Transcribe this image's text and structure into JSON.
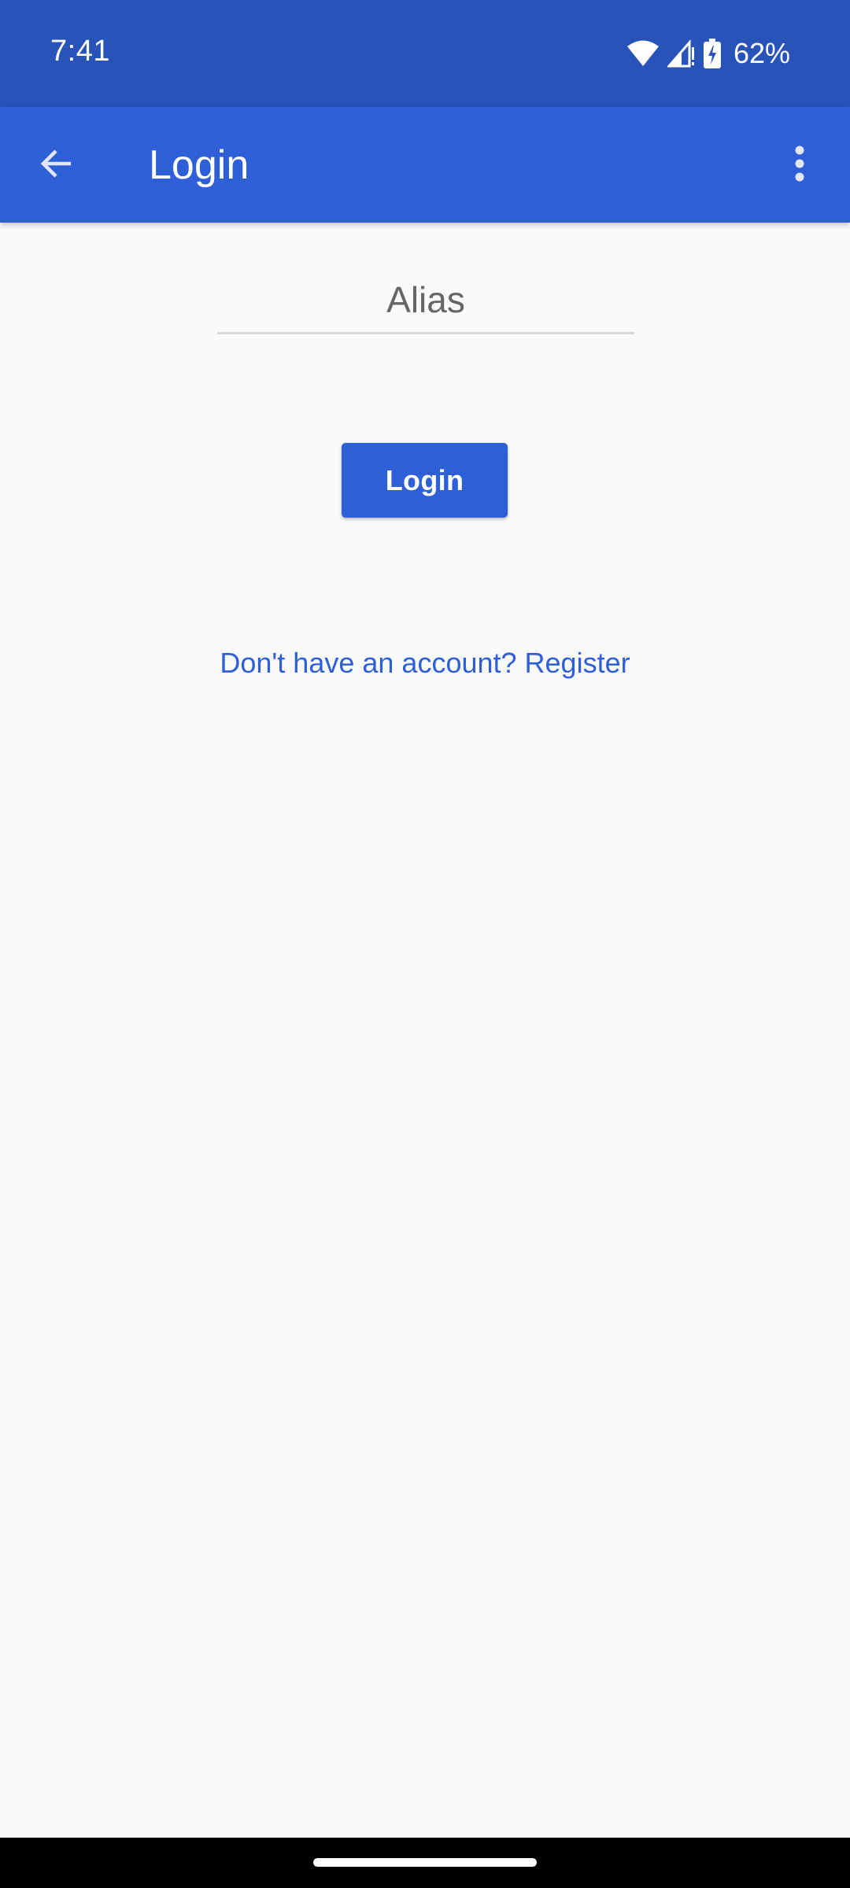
{
  "status_bar": {
    "time": "7:41",
    "battery_percent": "62%",
    "icons": [
      "wifi-icon",
      "cellular-signal-icon",
      "battery-charging-icon"
    ],
    "background_color": "#2853b8"
  },
  "app_bar": {
    "title": "Login",
    "back_icon": "arrow-back-icon",
    "menu_icon": "more-vert-icon",
    "background_color": "#2e5fd6"
  },
  "form": {
    "alias_placeholder": "Alias",
    "alias_value": "",
    "login_button_label": "Login",
    "register_link_text": "Don't have an account? Register",
    "accent_color": "#2e5fd6"
  },
  "nav_bar": {
    "home_indicator": "gesture-home-handle"
  }
}
